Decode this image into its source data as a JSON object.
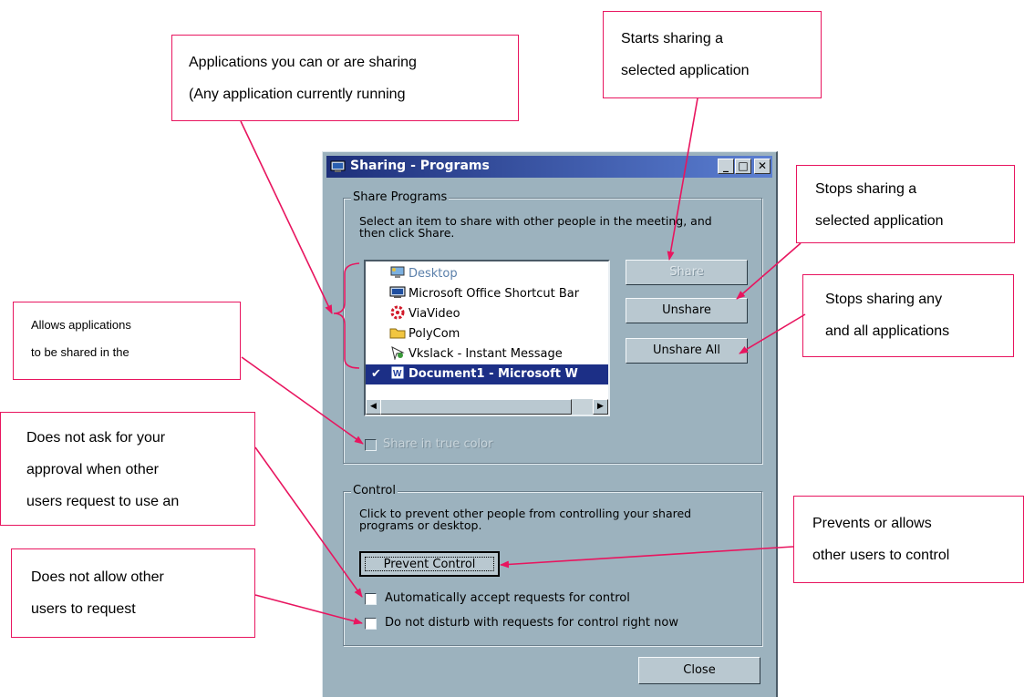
{
  "dialog": {
    "title": "Sharing - Programs",
    "share_group": {
      "legend": "Share Programs",
      "instructions": [
        "Select an item to share with other people in the meeting, and",
        "then click Share."
      ],
      "programs": [
        {
          "label": "Desktop",
          "icon": "desktop-icon"
        },
        {
          "label": "Microsoft Office Shortcut Bar",
          "icon": "office-bar-icon"
        },
        {
          "label": "ViaVideo",
          "icon": "viavideo-icon"
        },
        {
          "label": "PolyCom",
          "icon": "folder-icon"
        },
        {
          "label": "Vkslack - Instant Message",
          "icon": "messenger-icon"
        },
        {
          "label": "Document1 - Microsoft W",
          "icon": "word-icon",
          "selected": true,
          "checked": true
        }
      ],
      "share_label": "Share",
      "unshare_label": "Unshare",
      "unshare_all_label": "Unshare All",
      "true_color_label": "Share in true color"
    },
    "control_group": {
      "legend": "Control",
      "instructions": [
        "Click to prevent other people from controlling your shared",
        "programs or desktop."
      ],
      "prevent_label": "Prevent Control",
      "auto_accept_label": "Automatically accept requests for control",
      "do_not_disturb_label": "Do not disturb with requests for control right now"
    },
    "close_label": "Close"
  },
  "callouts": {
    "applications": [
      "Applications you can or are sharing",
      "(Any application currently running"
    ],
    "share": [
      "Starts sharing a",
      "selected application"
    ],
    "unshare": [
      "Stops sharing a",
      "selected application"
    ],
    "unshare_all": [
      "Stops sharing any",
      "and all applications"
    ],
    "true_color": [
      "Allows applications",
      "to be shared in the"
    ],
    "auto_accept": [
      "Does not ask for your",
      "approval when other",
      "users request to use an"
    ],
    "do_not_disturb": [
      "Does not allow other",
      "users to request"
    ],
    "prevent_control": [
      "Prevents or allows",
      "other users to control"
    ]
  },
  "colors": {
    "callout_border": "#e8155f",
    "title_bar": "#1d2f7a",
    "dialog_face": "#9cb2be",
    "selection": "#1c2f86"
  }
}
